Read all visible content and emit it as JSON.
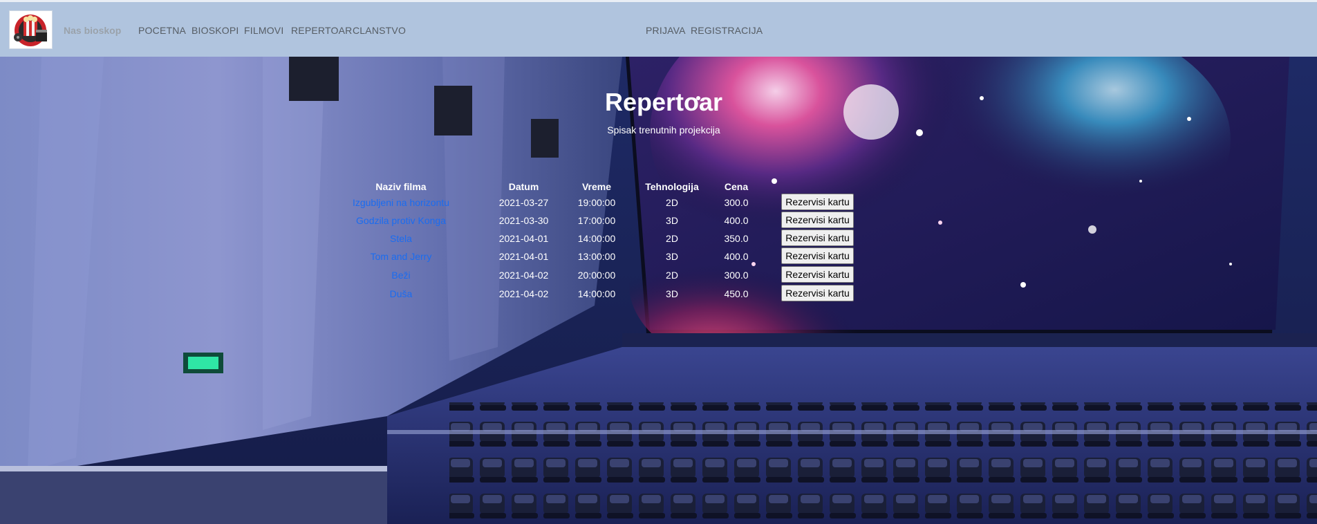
{
  "navbar": {
    "brand": "Nas bioskop",
    "links": [
      "POCETNA",
      "BIOSKOPI",
      "FILMOVI",
      "REPERTOAR",
      "CLANSTVO"
    ],
    "auth_links": [
      "PRIJAVA",
      "REGISTRACIJA"
    ]
  },
  "main": {
    "title": "Repertoar",
    "subtitle": "Spisak trenutnih projekcija"
  },
  "table": {
    "headers": [
      "Naziv filma",
      "Datum",
      "Vreme",
      "Tehnologija",
      "Cena"
    ],
    "rows": [
      {
        "film": "Izgubljeni na horizontu",
        "date": "2021-03-27",
        "time": "19:00:00",
        "tech": "2D",
        "price": "300.0",
        "action": "Rezervisi kartu"
      },
      {
        "film": "Godzila protiv Konga",
        "date": "2021-03-30",
        "time": "17:00:00",
        "tech": "3D",
        "price": "400.0",
        "action": "Rezervisi kartu"
      },
      {
        "film": "Stela",
        "date": "2021-04-01",
        "time": "14:00:00",
        "tech": "2D",
        "price": "350.0",
        "action": "Rezervisi kartu"
      },
      {
        "film": "Tom and Jerry",
        "date": "2021-04-01",
        "time": "13:00:00",
        "tech": "3D",
        "price": "400.0",
        "action": "Rezervisi kartu"
      },
      {
        "film": "Beži",
        "date": "2021-04-02",
        "time": "20:00:00",
        "tech": "2D",
        "price": "300.0",
        "action": "Rezervisi kartu"
      },
      {
        "film": "Duša",
        "date": "2021-04-02",
        "time": "14:00:00",
        "tech": "3D",
        "price": "450.0",
        "action": "Rezervisi kartu"
      }
    ]
  },
  "colors": {
    "navbar_bg": "#b0c4de",
    "link": "#1a6cf0",
    "text": "#ffffff"
  }
}
